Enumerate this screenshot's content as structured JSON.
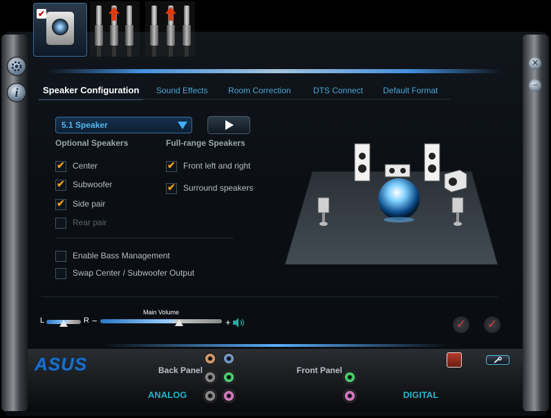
{
  "tabs": [
    {
      "label": "Speaker Configuration"
    },
    {
      "label": "Sound Effects"
    },
    {
      "label": "Room Correction"
    },
    {
      "label": "DTS Connect"
    },
    {
      "label": "Default Format"
    }
  ],
  "speaker_select": {
    "value": "5.1 Speaker"
  },
  "optional": {
    "heading": "Optional Speakers",
    "items": [
      {
        "label": "Center",
        "checked": true
      },
      {
        "label": "Subwoofer",
        "checked": true
      },
      {
        "label": "Side pair",
        "checked": true
      },
      {
        "label": "Rear pair",
        "checked": false
      }
    ]
  },
  "fullrange": {
    "heading": "Full-range Speakers",
    "items": [
      {
        "label": "Front left and right",
        "checked": true
      },
      {
        "label": "Surround speakers",
        "checked": true
      }
    ]
  },
  "options": [
    {
      "label": "Enable Bass Management",
      "checked": false
    },
    {
      "label": "Swap Center / Subwoofer Output",
      "checked": false
    }
  ],
  "volume": {
    "left_label": "L",
    "right_label": "R",
    "main_label": "Main Volume",
    "minus": "−",
    "plus": "+",
    "balance_level": 0.5,
    "main_level": 0.65
  },
  "bottom": {
    "brand": "ASUS",
    "back_panel": "Back Panel",
    "front_panel": "Front Panel",
    "analog": "ANALOG",
    "digital": "DIGITAL"
  },
  "colors": {
    "accent": "#4aa8d8",
    "check": "#f0a020",
    "analog_label": "#21b3c8",
    "port_orange": "#c98a55",
    "port_blue": "#5b86b8",
    "port_gray": "#777777",
    "port_green": "#2fc35a",
    "port_pink": "#c865b5"
  },
  "icons": [
    "settings-gear-icon",
    "info-icon",
    "close-icon",
    "minimize-icon",
    "speaker-device-icon",
    "play-icon",
    "volume-speaker-icon",
    "check-icon",
    "wrench-icon",
    "digital-output-icon"
  ]
}
